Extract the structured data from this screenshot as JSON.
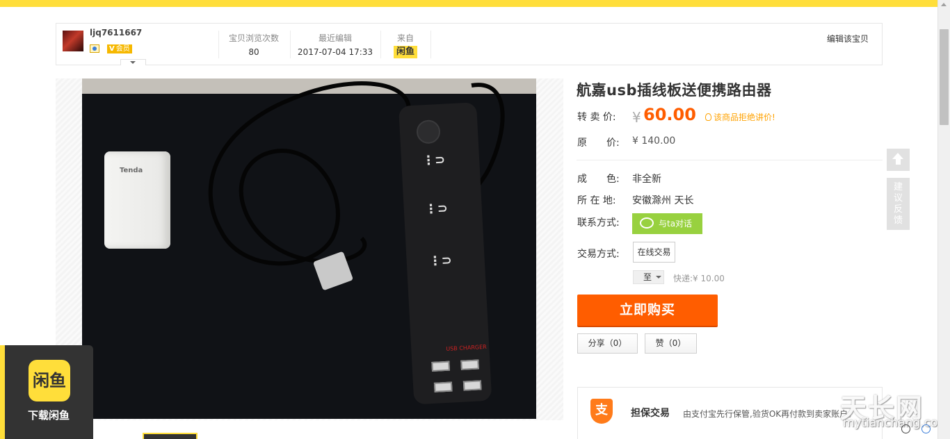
{
  "seller": {
    "username": "ljq7611667",
    "member_badge": "会员",
    "member_badge_prefix": "V"
  },
  "stats": {
    "views_label": "宝贝浏览次数",
    "views_value": "80",
    "edited_label": "最近编辑",
    "edited_value": "2017-07-04 17:33",
    "from_label": "来自",
    "from_value": "闲鱼"
  },
  "edit_link": "编辑该宝贝",
  "product": {
    "title": "航嘉usb插线板送便携路由器",
    "photo_router_brand": "Tenda",
    "photo_usb_label": "USB CHARGER",
    "price_label": "转 卖 价:",
    "price_currency": "¥",
    "price": "60.00",
    "no_bargain": "该商品拒绝讲价!",
    "orig_label": "原　　价:",
    "orig_price": "¥ 140.00",
    "condition_label": "成　　色:",
    "condition_value": "非全新",
    "location_label": "所 在 地:",
    "location_value": "安徽滁州 天长",
    "contact_label": "联系方式:",
    "contact_button": "与ta对话",
    "trade_label": "交易方式:",
    "trade_option": "在线交易",
    "destination_value": "至",
    "shipping": "快递:¥ 10.00",
    "buy_button": "立即购买",
    "share_button": "分享（0）",
    "like_button": "赞（0）"
  },
  "guarantee": {
    "icon_text": "支",
    "title": "担保交易",
    "desc": "由支付宝先行保管,验货OK再付款到卖家账户。"
  },
  "side_tools": {
    "feedback": "建议反馈"
  },
  "app_promo": {
    "logo_text": "闲鱼",
    "label": "下载闲鱼"
  },
  "watermark": {
    "brand": "天长网",
    "url": "mytianchang.com"
  },
  "colors": {
    "brand_yellow": "#ffde3a",
    "price_orange": "#ff5d00",
    "chat_green": "#98d13f"
  }
}
